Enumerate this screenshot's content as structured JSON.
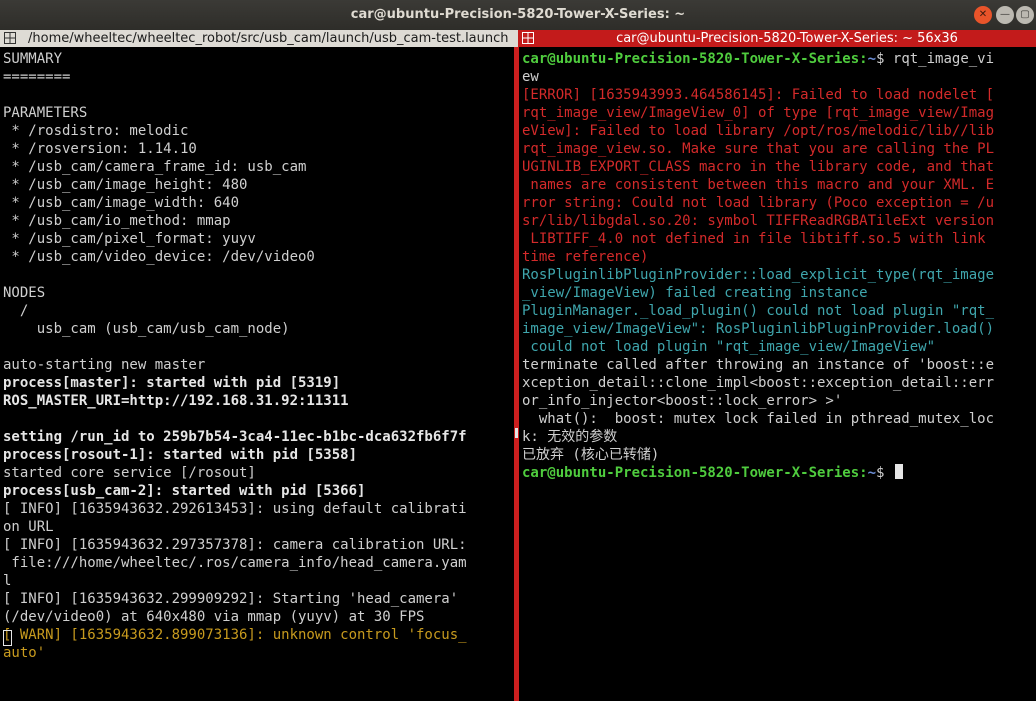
{
  "window": {
    "title": "car@ubuntu-Precision-5820-Tower-X-Series: ~",
    "close_glyph": "✕",
    "min_glyph": "—",
    "max_glyph": "▢"
  },
  "left_terminal": {
    "tab_title": "/home/wheeltec/wheeltec_robot/src/usb_cam/launch/usb_cam-test.launch",
    "lines": [
      "SUMMARY",
      "========",
      "",
      "PARAMETERS",
      " * /rosdistro: melodic",
      " * /rosversion: 1.14.10",
      " * /usb_cam/camera_frame_id: usb_cam",
      " * /usb_cam/image_height: 480",
      " * /usb_cam/image_width: 640",
      " * /usb_cam/io_method: mmap",
      " * /usb_cam/pixel_format: yuyv",
      " * /usb_cam/video_device: /dev/video0",
      "",
      "NODES",
      "  /",
      "    usb_cam (usb_cam/usb_cam_node)",
      "",
      "auto-starting new master",
      "process[master]: started with pid [5319]",
      "ROS_MASTER_URI=http://192.168.31.92:11311",
      "",
      "setting /run_id to 259b7b54-3ca4-11ec-b1bc-dca632fb6f7f",
      "process[rosout-1]: started with pid [5358]",
      "started core service [/rosout]",
      "process[usb_cam-2]: started with pid [5366]",
      "[ INFO] [1635943632.292613453]: using default calibrati",
      "on URL",
      "[ INFO] [1635943632.297357378]: camera calibration URL:",
      " file:///home/wheeltec/.ros/camera_info/head_camera.yam",
      "l",
      "[ INFO] [1635943632.299909292]: Starting 'head_camera'",
      "(/dev/video0) at 640x480 via mmap (yuyv) at 30 FPS",
      "[ WARN] [1635943632.899073136]: unknown control 'focus_",
      "auto'"
    ]
  },
  "right_terminal": {
    "tab_title": "car@ubuntu-Precision-5820-Tower-X-Series: ~ 56x36",
    "prompt_user": "car@ubuntu-Precision-5820-Tower-X-Series",
    "prompt_sep": ":",
    "prompt_path": "~",
    "prompt_end": "$ ",
    "command_line1": "rqt_image_vi",
    "command_line2": "ew",
    "lines": [
      "[ERROR] [1635943993.464586145]: Failed to load nodelet [",
      "rqt_image_view/ImageView_0] of type [rqt_image_view/Imag",
      "eView]: Failed to load library /opt/ros/melodic/lib//lib",
      "rqt_image_view.so. Make sure that you are calling the PL",
      "UGINLIB_EXPORT_CLASS macro in the library code, and that",
      " names are consistent between this macro and your XML. E",
      "rror string: Could not load library (Poco exception = /u",
      "sr/lib/libgdal.so.20: symbol TIFFReadRGBATileExt version",
      " LIBTIFF_4.0 not defined in file libtiff.so.5 with link",
      "time reference)",
      "RosPluginlibPluginProvider::load_explicit_type(rqt_image",
      "_view/ImageView) failed creating instance",
      "PluginManager._load_plugin() could not load plugin \"rqt_",
      "image_view/ImageView\": RosPluginlibPluginProvider.load()",
      " could not load plugin \"rqt_image_view/ImageView\"",
      "terminate called after throwing an instance of 'boost::e",
      "xception_detail::clone_impl<boost::exception_detail::err",
      "or_info_injector<boost::lock_error> >'",
      "  what():  boost: mutex lock failed in pthread_mutex_loc",
      "k: 无效的参数",
      "已放弃 (核心已转储)"
    ]
  },
  "colors": {
    "titlebar": "#2e2d29",
    "separator": "#cc1f1f",
    "error": "#d32a2a",
    "teal": "#3fa6ad",
    "warn": "#c79a1e",
    "prompt_user": "#4fcc3e",
    "prompt_path": "#6b8ed6"
  }
}
